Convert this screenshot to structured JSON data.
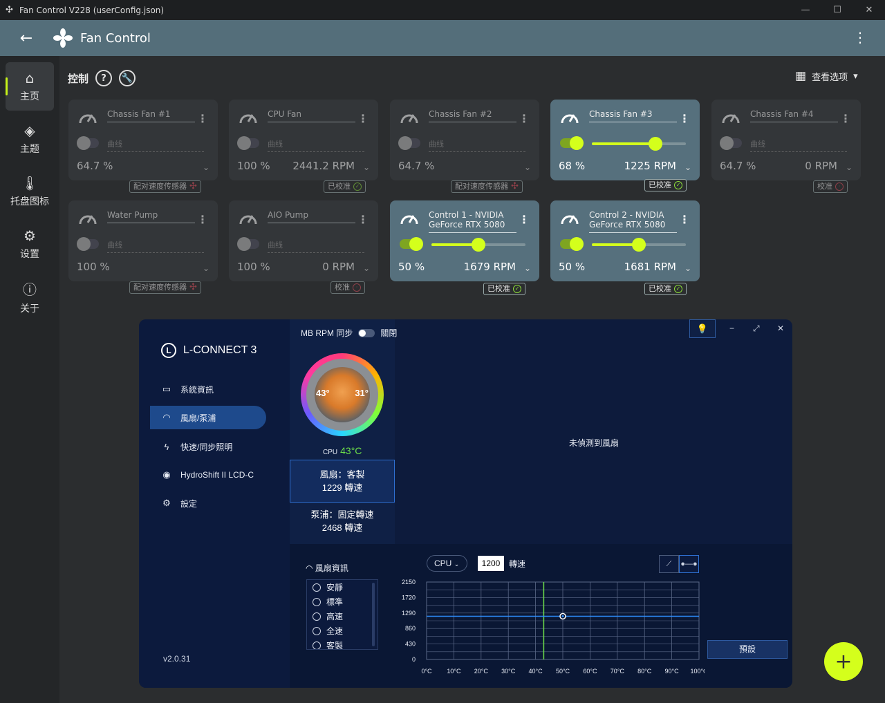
{
  "window": {
    "title": "Fan Control V228 (userConfig.json)",
    "min": "—",
    "max": "☐",
    "close": "✕"
  },
  "appbar": {
    "title": "Fan Control"
  },
  "sidebar": {
    "items": [
      {
        "label": "主页",
        "icon": "home-icon",
        "glyph": "⌂"
      },
      {
        "label": "主题",
        "icon": "paint-bucket-icon",
        "glyph": "◈"
      },
      {
        "label": "托盘图标",
        "icon": "thermometer-icon",
        "glyph": "🌡"
      },
      {
        "label": "设置",
        "icon": "gear-icon",
        "glyph": "⚙"
      },
      {
        "label": "关于",
        "icon": "info-icon",
        "glyph": "ⓘ"
      }
    ]
  },
  "header": {
    "title": "控制",
    "help": "?",
    "view_options": "查看选项"
  },
  "cards": [
    {
      "name": "Chassis Fan #1",
      "curve": "曲线",
      "pct": "64.7 %",
      "rpm": "",
      "badge": "配对速度传感器",
      "state": "dim",
      "status": "bad"
    },
    {
      "name": "CPU Fan",
      "curve": "曲线",
      "pct": "100 %",
      "rpm": "2441.2 RPM",
      "badge": "已校准",
      "state": "dim",
      "status": "ok"
    },
    {
      "name": "Chassis Fan #2",
      "curve": "曲线",
      "pct": "64.7 %",
      "rpm": "",
      "badge": "配对速度传感器",
      "state": "dim",
      "status": "bad"
    },
    {
      "name": "Chassis Fan #3",
      "curve": "",
      "pct": "68 %",
      "rpm": "1225 RPM",
      "badge": "已校准",
      "state": "on",
      "status": "ok",
      "level": 0.68
    },
    {
      "name": "Chassis Fan #4",
      "curve": "曲线",
      "pct": "64.7 %",
      "rpm": "0 RPM",
      "badge": "校准",
      "state": "dim",
      "status": "pending"
    },
    {
      "name": "Water Pump",
      "curve": "曲线",
      "pct": "100 %",
      "rpm": "",
      "badge": "配对速度传感器",
      "state": "dim",
      "status": "bad"
    },
    {
      "name": "AIO Pump",
      "curve": "曲线",
      "pct": "100 %",
      "rpm": "0 RPM",
      "badge": "校准",
      "state": "dim",
      "status": "pending"
    },
    {
      "name": "Control 1 - NVIDIA GeForce RTX 5080",
      "curve": "",
      "pct": "50 %",
      "rpm": "1679 RPM",
      "badge": "已校准",
      "state": "on",
      "status": "ok",
      "level": 0.5
    },
    {
      "name": "Control 2 - NVIDIA GeForce RTX 5080",
      "curve": "",
      "pct": "50 %",
      "rpm": "1681 RPM",
      "badge": "已校准",
      "state": "on",
      "status": "ok",
      "level": 0.5
    }
  ],
  "fab": "+",
  "lconnect": {
    "brand": "L-CONNECT 3",
    "nav": [
      {
        "label": "系統資訊",
        "glyph": "▭"
      },
      {
        "label": "風扇/泵浦",
        "glyph": "◠"
      },
      {
        "label": "快速/同步照明",
        "glyph": "ϟ"
      },
      {
        "label": "HydroShift II LCD-C",
        "glyph": "◉"
      },
      {
        "label": "設定",
        "glyph": "⚙"
      }
    ],
    "version": "v2.0.31",
    "mb_sync": "MB RPM 同步",
    "mb_state": "關閉",
    "lcd_left": "43°",
    "lcd_right": "31°",
    "cpu_label": "CPU",
    "cpu_temp": "43°C",
    "fan_line1": "風扇：客製",
    "fan_line2": "1229 轉速",
    "pump_line1": "泵浦：固定轉速",
    "pump_line2": "2468 轉速",
    "no_fan": "未偵測到風扇",
    "fan_info": "風扇資訊",
    "modes": [
      "安靜",
      "標準",
      "高速",
      "全速",
      "客製"
    ],
    "sensor": "CPU",
    "rpm_value": "1200",
    "rpm_unit": "轉速",
    "preset": "預設",
    "controls": {
      "min": "−",
      "max": "⤢",
      "close": "✕"
    }
  },
  "chart_data": {
    "type": "line",
    "x": [
      0,
      10,
      20,
      30,
      40,
      50,
      60,
      70,
      80,
      90,
      100
    ],
    "xlabels": [
      "0°C",
      "10°C",
      "20°C",
      "30°C",
      "40°C",
      "50°C",
      "60°C",
      "70°C",
      "80°C",
      "90°C",
      "100°C"
    ],
    "yticks": [
      0,
      430,
      860,
      1290,
      1720,
      2150
    ],
    "ylim": [
      0,
      2150
    ],
    "xlim": [
      0,
      100
    ],
    "series": [
      {
        "values": [
          1200,
          1200,
          1200,
          1200,
          1200,
          1200,
          1200,
          1200,
          1200,
          1200,
          1200
        ]
      }
    ],
    "point": {
      "x": 50,
      "y": 1200
    },
    "current_temp": 43,
    "colors": {
      "line": "#2e8fff",
      "marker": "#6ee04a",
      "grid": "#5a6888"
    }
  }
}
